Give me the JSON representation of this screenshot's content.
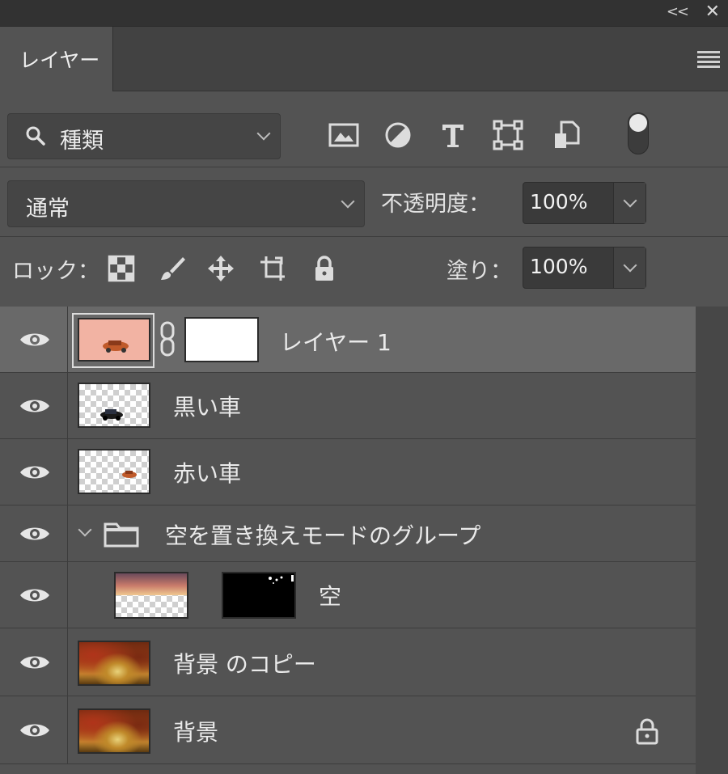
{
  "panel": {
    "collapse_glyph": "<<",
    "close_glyph": "✕",
    "tab_label": "レイヤー",
    "menu_icon": "hamburger-icon"
  },
  "filter": {
    "kind_label": "種類",
    "icons": [
      "image-filter-icon",
      "adjustment-filter-icon",
      "type-filter-icon",
      "shape-filter-icon",
      "smart-object-filter-icon"
    ],
    "toggle": "filter-toggle"
  },
  "blend": {
    "mode": "通常",
    "opacity_label": "不透明度：",
    "opacity_value": "100%"
  },
  "lock": {
    "label": "ロック：",
    "icons": [
      "lock-transparent-pixels-icon",
      "lock-image-pixels-icon",
      "lock-position-icon",
      "lock-artboard-icon",
      "lock-all-icon"
    ],
    "fill_label": "塗り：",
    "fill_value": "100%"
  },
  "layers": [
    {
      "name": "レイヤー 1",
      "selected": true,
      "visible": true,
      "has_mask": true
    },
    {
      "name": "黒い車",
      "visible": true
    },
    {
      "name": "赤い車",
      "visible": true
    },
    {
      "name": "空を置き換えモードのグループ",
      "visible": true,
      "is_group": true,
      "expanded": true
    },
    {
      "name": "空",
      "visible": true,
      "has_mask": true,
      "indent": true
    },
    {
      "name": "背景 のコピー",
      "visible": true
    },
    {
      "name": "背景",
      "visible": true,
      "locked": true
    }
  ],
  "colors": {
    "panel_bg": "#535353",
    "selected_row": "#696969",
    "field_bg": "#3a3a3a"
  }
}
